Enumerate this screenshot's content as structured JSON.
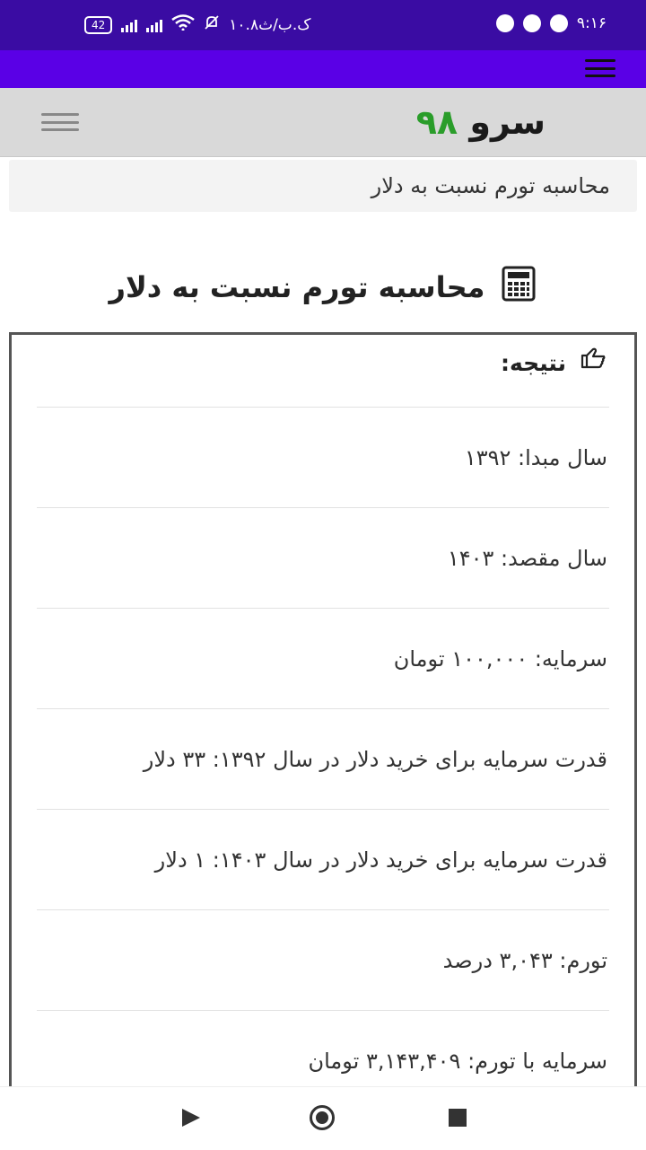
{
  "status_bar": {
    "time": "۹:۱۶",
    "speed": "۱۰.۸ک.ب/ث",
    "battery": "42"
  },
  "header": {
    "logo_word": "سرو",
    "logo_number": "۹۸"
  },
  "breadcrumb": "محاسبه تورم نسبت به دلار",
  "page_title": "محاسبه تورم نسبت به دلار",
  "result": {
    "heading": "نتیجه:",
    "rows": [
      "سال مبدا: ۱۳۹۲",
      "سال مقصد: ۱۴۰۳",
      "سرمایه: ۱۰۰,۰۰۰ تومان",
      "قدرت سرمایه برای خرید دلار در سال ۱۳۹۲: ۳۳ دلار",
      "قدرت سرمایه برای خرید دلار در سال ۱۴۰۳: ۱ دلار",
      "تورم: ۳,۰۴۳ درصد",
      "سرمایه با تورم: ۳,۱۴۳,۴۰۹ تومان"
    ]
  },
  "icons": {
    "title_icon": "calculator-icon",
    "result_icon": "hand-pointing-icon",
    "menu_icon": "hamburger-menu-icon"
  },
  "colors": {
    "status_bar": "#3a0ca3",
    "app_bar": "#5a00e6",
    "header_bg": "#d9d9d9",
    "logo_green": "#2a9d2a"
  }
}
